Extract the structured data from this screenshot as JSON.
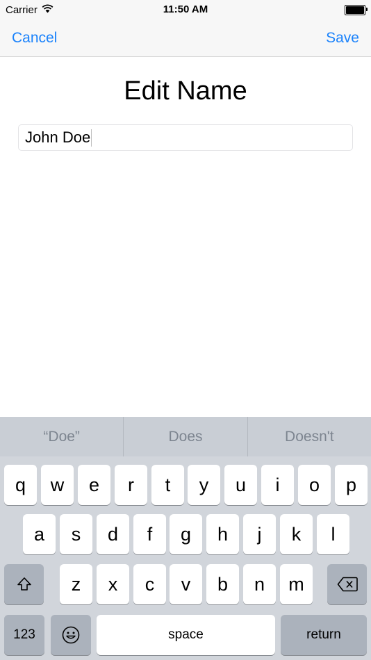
{
  "status_bar": {
    "carrier": "Carrier",
    "time": "11:50 AM"
  },
  "nav": {
    "cancel_label": "Cancel",
    "save_label": "Save"
  },
  "content": {
    "title": "Edit Name",
    "name_value": "John Doe"
  },
  "keyboard": {
    "suggestions": [
      "“Doe”",
      "Does",
      "Doesn't"
    ],
    "rows": [
      [
        "q",
        "w",
        "e",
        "r",
        "t",
        "y",
        "u",
        "i",
        "o",
        "p"
      ],
      [
        "a",
        "s",
        "d",
        "f",
        "g",
        "h",
        "j",
        "k",
        "l"
      ],
      [
        "z",
        "x",
        "c",
        "v",
        "b",
        "n",
        "m"
      ]
    ],
    "numbers_label": "123",
    "space_label": "space",
    "return_label": "return"
  },
  "colors": {
    "accent": "#1a82fb",
    "keyboard_bg": "#d1d5db",
    "suggestion_text": "#7d8590"
  }
}
